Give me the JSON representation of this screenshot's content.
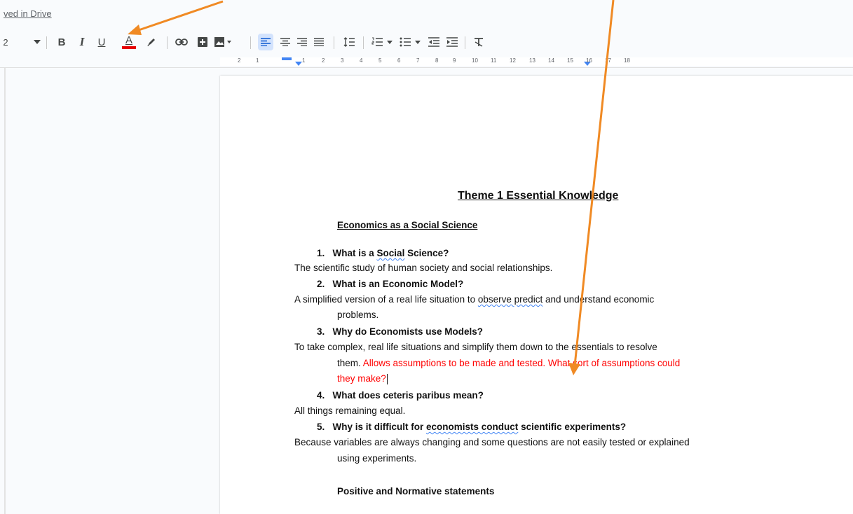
{
  "topbar": {
    "saved_text": "ved in Drive"
  },
  "toolbar": {
    "font_size": "2",
    "bold": "B",
    "italic": "I",
    "underline": "U",
    "text_color": "A",
    "text_color_value": "#e60000"
  },
  "ruler": {
    "left_labels": [
      "2",
      "1"
    ],
    "labels": [
      "1",
      "2",
      "3",
      "4",
      "5",
      "6",
      "7",
      "8",
      "9",
      "10",
      "11",
      "12",
      "13",
      "14",
      "15",
      "16",
      "17",
      "18"
    ]
  },
  "document": {
    "title": "Theme 1 Essential Knowledge",
    "subtitle": "Economics as a Social Science",
    "q1": {
      "num": "1.",
      "a": "What is a ",
      "b": "Social",
      "c": " Science?"
    },
    "a1": "The scientific study of human society and social relationships.",
    "q2": {
      "num": "2.",
      "text": "What is an Economic Model?"
    },
    "a2": {
      "a": "A simplified version of a real life situation to ",
      "b": "observe predict",
      "c": " and understand economic",
      "d": "problems."
    },
    "q3": {
      "num": "3.",
      "text": "Why do Economists use Models?"
    },
    "a3": {
      "line1": "To take complex, real life situations and simplify them down to the essentials to resolve",
      "line2_black": "them.  ",
      "line2_red": "Allows assumptions to be made and tested.  What sort of assumptions could",
      "line3_red": "they make?"
    },
    "q4": {
      "num": "4.",
      "text": "What does ceteris paribus mean?"
    },
    "a4": "All things remaining equal.",
    "q5": {
      "num": "5.",
      "a": "Why is it difficult for ",
      "b": "economists conduct",
      "c": " scientific experiments?"
    },
    "a5": {
      "line1": "Because variables are always changing and some questions are not easily tested or explained",
      "line2": "using experiments."
    },
    "next_heading": "Positive and Normative statements"
  },
  "colors": {
    "annotation_arrow": "#f08a24",
    "page": "#ffffff",
    "background": "#f9fbfd",
    "red_text": "#ff0000"
  }
}
